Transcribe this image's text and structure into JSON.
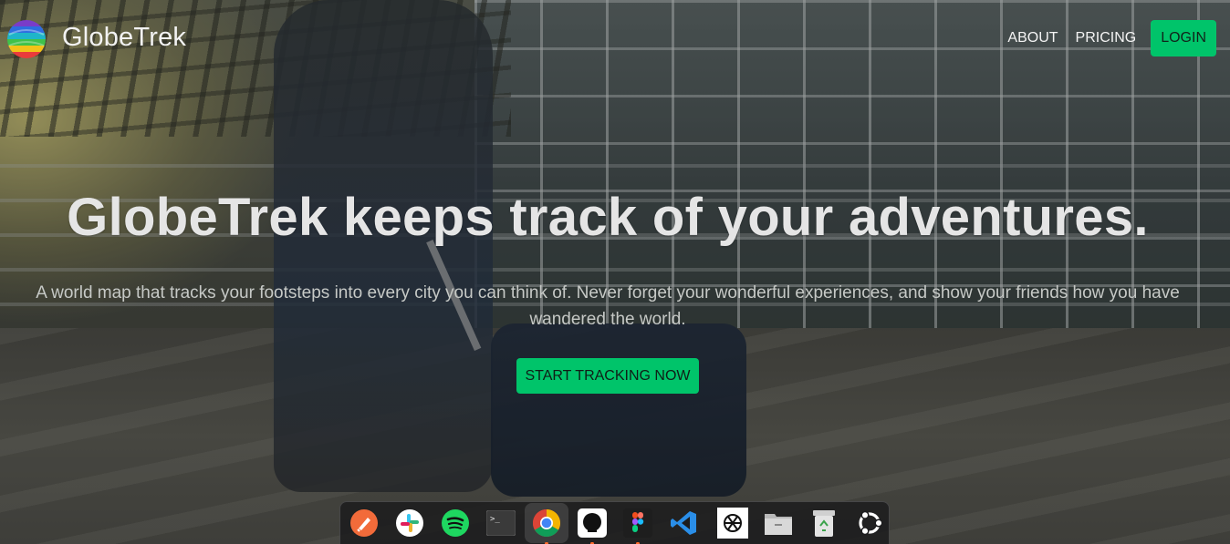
{
  "brand": {
    "name": "GlobeTrek",
    "logo_icon": "globe-logo-icon"
  },
  "nav": {
    "about": "ABOUT",
    "pricing": "PRICING",
    "login": "LOGIN"
  },
  "hero": {
    "title": "GlobeTrek keeps track of your adventures.",
    "subtitle": "A world map that tracks your footsteps into every city you can think of. Never forget your wonderful experiences, and show your friends how you have wandered the world.",
    "cta": "START TRACKING NOW"
  },
  "colors": {
    "accent": "#00c46a",
    "dock_bg": "#1c1c1e"
  },
  "dock": {
    "apps": [
      {
        "name": "postman",
        "icon": "postman-icon"
      },
      {
        "name": "slack",
        "icon": "slack-icon"
      },
      {
        "name": "spotify",
        "icon": "spotify-icon"
      },
      {
        "name": "terminal",
        "icon": "terminal-icon",
        "label": ">_"
      },
      {
        "name": "chrome",
        "icon": "chrome-icon",
        "active": true
      },
      {
        "name": "github",
        "icon": "github-icon"
      },
      {
        "name": "figma",
        "icon": "figma-icon"
      },
      {
        "name": "vscode",
        "icon": "vscode-icon"
      },
      {
        "name": "chatgpt",
        "icon": "chatgpt-icon"
      },
      {
        "name": "files",
        "icon": "folder-icon"
      },
      {
        "name": "trash",
        "icon": "trash-icon"
      },
      {
        "name": "ubuntu",
        "icon": "ubuntu-icon"
      }
    ]
  }
}
